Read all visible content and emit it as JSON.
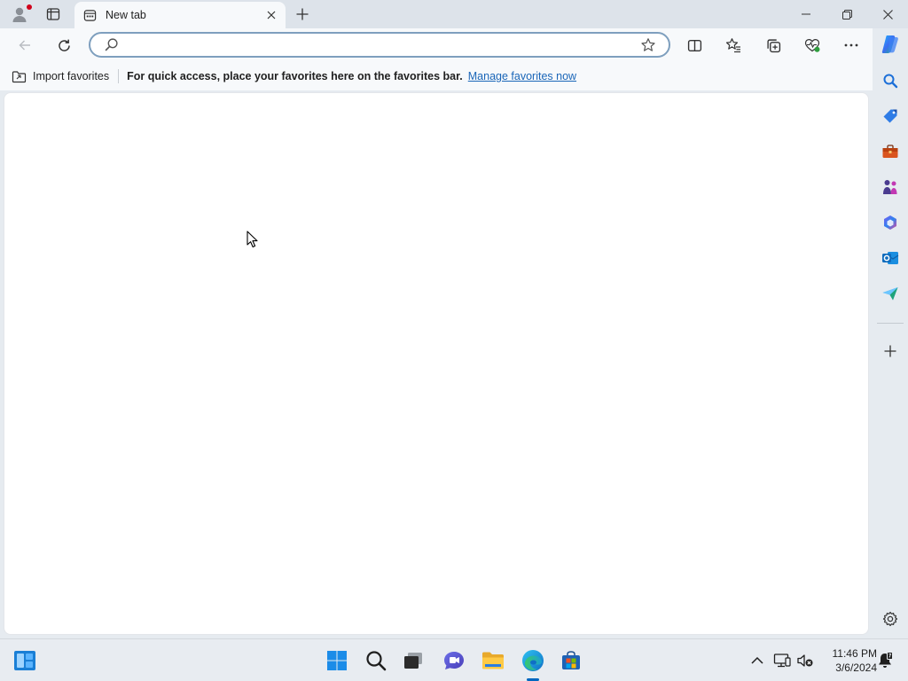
{
  "window": {
    "tab_title": "New tab"
  },
  "addressbar": {
    "value": "",
    "placeholder": ""
  },
  "favorites_bar": {
    "import_label": "Import favorites",
    "hint": "For quick access, place your favorites here on the favorites bar.",
    "manage_link": "Manage favorites now"
  },
  "sidebar": {
    "items": [
      "search-icon",
      "shopping-tag-icon",
      "tools-briefcase-icon",
      "games-icon",
      "microsoft365-icon",
      "outlook-icon",
      "drop-send-icon",
      "add-icon",
      "settings-icon"
    ]
  },
  "taskbar": {
    "apps": [
      "widgets-icon",
      "start-icon",
      "search-icon",
      "task-view-icon",
      "teams-chat-icon",
      "file-explorer-icon",
      "edge-icon",
      "store-icon"
    ],
    "clock_time": "11:46 PM",
    "clock_date": "3/6/2024"
  },
  "colors": {
    "accent": "#0067c0",
    "link": "#1a66b8",
    "frame": "#dde3ea",
    "toolbar": "#f7f9fb"
  }
}
